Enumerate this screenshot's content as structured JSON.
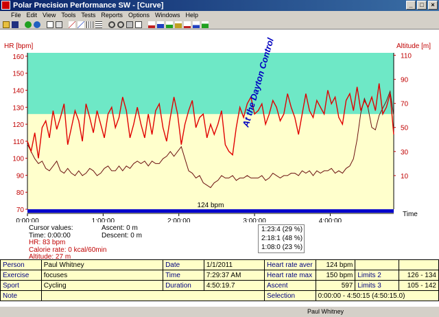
{
  "window": {
    "title": "Polar Precision Performance SW - [Curve]"
  },
  "menu": [
    "File",
    "Edit",
    "View",
    "Tools",
    "Tests",
    "Reports",
    "Options",
    "Windows",
    "Help"
  ],
  "chart_data": {
    "type": "line",
    "left_axis_title": "HR [bpm]",
    "right_axis_title": "Altitude [m]",
    "x_axis_title": "Time",
    "x_ticks": [
      "0:00:00",
      "1:00:00",
      "2:00:00",
      "3:00:00",
      "4:00:00"
    ],
    "hr_ticks": [
      70,
      80,
      90,
      100,
      110,
      120,
      130,
      140,
      150,
      160
    ],
    "altitude_ticks": [
      10,
      30,
      50,
      70,
      90,
      110
    ],
    "hr_range": [
      70,
      162
    ],
    "altitude_range": [
      -18,
      112
    ],
    "time_range_seconds": [
      0,
      17419
    ],
    "upper_zone_start_bpm": 126,
    "annotation": "At the Dayton Control",
    "average_label": "124 bpm",
    "series": [
      {
        "name": "HR",
        "color": "#e00000",
        "x_seconds": [
          0,
          174,
          348,
          523,
          697,
          871,
          1045,
          1219,
          1394,
          1568,
          1742,
          1916,
          2090,
          2265,
          2439,
          2613,
          2787,
          2961,
          3136,
          3310,
          3484,
          3658,
          3832,
          4006,
          4181,
          4355,
          4529,
          4703,
          4877,
          5052,
          5226,
          5400,
          5574,
          5748,
          5923,
          6097,
          6271,
          6445,
          6619,
          6794,
          6968,
          7142,
          7316,
          7490,
          7665,
          7839,
          8013,
          8187,
          8361,
          8535,
          8710,
          8884,
          9058,
          9232,
          9406,
          9581,
          9755,
          9929,
          10103,
          10277,
          10452,
          10626,
          10800,
          10974,
          11148,
          11323,
          11497,
          11671,
          11845,
          12019,
          12194,
          12368,
          12542,
          12716,
          12890,
          13064,
          13239,
          13413,
          13587,
          13761,
          13935,
          14110,
          14284,
          14458,
          14632,
          14806,
          14981,
          15155,
          15329,
          15503,
          15677,
          15852,
          16026,
          16200,
          16374,
          16548,
          16723,
          16897,
          17071,
          17245,
          17419
        ],
        "values": [
          110,
          104,
          115,
          100,
          118,
          122,
          112,
          128,
          117,
          124,
          132,
          108,
          118,
          128,
          122,
          110,
          132,
          124,
          115,
          128,
          120,
          112,
          126,
          130,
          118,
          124,
          136,
          128,
          112,
          120,
          130,
          120,
          112,
          126,
          114,
          128,
          132,
          118,
          110,
          124,
          136,
          126,
          108,
          120,
          128,
          134,
          118,
          124,
          126,
          112,
          120,
          114,
          120,
          128,
          108,
          104,
          102,
          118,
          130,
          124,
          132,
          136,
          126,
          128,
          132,
          120,
          126,
          134,
          130,
          122,
          126,
          138,
          130,
          124,
          114,
          126,
          138,
          128,
          124,
          134,
          130,
          126,
          140,
          132,
          136,
          124,
          120,
          134,
          138,
          128,
          142,
          128,
          134,
          130,
          136,
          128,
          144,
          126,
          130,
          138,
          114
        ]
      },
      {
        "name": "Altitude",
        "color": "#6b1010",
        "x_seconds": [
          0,
          174,
          348,
          523,
          697,
          871,
          1045,
          1219,
          1394,
          1568,
          1742,
          1916,
          2090,
          2265,
          2439,
          2613,
          2787,
          2961,
          3136,
          3310,
          3484,
          3658,
          3832,
          4006,
          4181,
          4355,
          4529,
          4703,
          4877,
          5052,
          5226,
          5400,
          5574,
          5748,
          5923,
          6097,
          6271,
          6445,
          6619,
          6794,
          6968,
          7142,
          7316,
          7490,
          7665,
          7839,
          8013,
          8187,
          8361,
          8535,
          8710,
          8884,
          9058,
          9232,
          9406,
          9581,
          9755,
          9929,
          10103,
          10277,
          10452,
          10626,
          10800,
          10974,
          11148,
          11323,
          11497,
          11671,
          11845,
          12019,
          12194,
          12368,
          12542,
          12716,
          12890,
          13064,
          13239,
          13413,
          13587,
          13761,
          13935,
          14110,
          14284,
          14458,
          14632,
          14806,
          14981,
          15155,
          15329,
          15503,
          15677,
          15852,
          16026,
          16200,
          16374,
          16548,
          16723,
          16897,
          17071,
          17245,
          17419
        ],
        "values": [
          36,
          30,
          24,
          20,
          22,
          16,
          14,
          18,
          22,
          14,
          12,
          16,
          12,
          10,
          14,
          10,
          12,
          16,
          14,
          10,
          12,
          16,
          18,
          14,
          14,
          18,
          14,
          18,
          16,
          20,
          22,
          20,
          22,
          18,
          22,
          20,
          20,
          24,
          26,
          30,
          26,
          30,
          34,
          24,
          14,
          12,
          8,
          10,
          4,
          2,
          0,
          4,
          6,
          10,
          8,
          8,
          10,
          6,
          8,
          8,
          10,
          8,
          8,
          8,
          10,
          6,
          8,
          12,
          10,
          8,
          10,
          10,
          12,
          12,
          10,
          14,
          12,
          14,
          10,
          14,
          12,
          14,
          14,
          16,
          12,
          14,
          12,
          16,
          18,
          24,
          40,
          62,
          74,
          66,
          50,
          48,
          60,
          66,
          72,
          80,
          60
        ]
      }
    ]
  },
  "info": {
    "cursor_values_label": "Cursor values:",
    "time": "Time: 0:00:00",
    "hr": "HR: 83 bpm",
    "calorie": "Calorie rate: 0 kcal/60min",
    "altitude": "Altitude: 27 m",
    "ascent": "Ascent: 0 m",
    "descent": "Descent: 0 m"
  },
  "laps": [
    "1:23:4  (29 %)",
    "2:18:1  (48 %)",
    "1:08:0  (23 %)"
  ],
  "table": {
    "person_label": "Person",
    "person_value": "Paul Whitney",
    "exercise_label": "Exercise",
    "exercise_value": "focuses",
    "sport_label": "Sport",
    "sport_value": "Cycling",
    "note_label": "Note",
    "date_label": "Date",
    "date_value": "1/1/2011",
    "time_label": "Time",
    "time_value": "7:29:37 AM",
    "duration_label": "Duration",
    "duration_value": "4:50:19.7",
    "hr_aver_label": "Heart rate aver",
    "hr_aver_value": "124 bpm",
    "hr_max_label": "Heart rate max",
    "hr_max_value": "150 bpm",
    "ascent_label": "Ascent",
    "ascent_value": "597",
    "selection_label": "Selection",
    "selection_value": "0:00:00 - 4:50:15 (4:50:15.0)",
    "limits2_label": "Limits 2",
    "limits2_value": "126 - 134",
    "limits3_label": "Limits 3",
    "limits3_value": "105 - 142"
  },
  "status": {
    "user": "Paul Whitney"
  },
  "colors": {
    "upper_zone": "#6ee8c6",
    "lower_zone": "#ffffcc",
    "hr_line": "#e00000",
    "altitude_line": "#6b1010",
    "avg_bar": "#0000cc"
  }
}
